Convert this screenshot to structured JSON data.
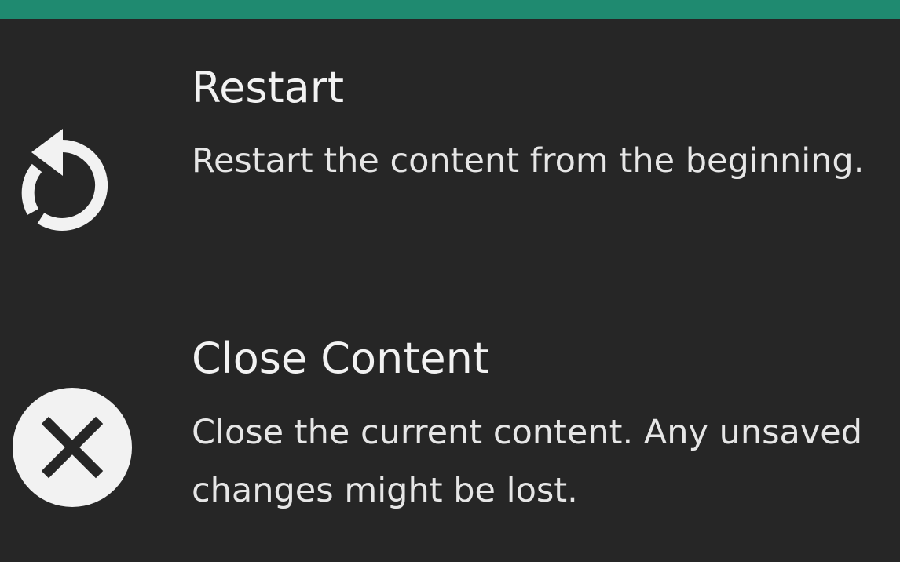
{
  "header": {
    "accent_color": "#1f8a70"
  },
  "menu": {
    "items": [
      {
        "icon": "restart-icon",
        "title": "Restart",
        "description": "Restart the content from the beginning."
      },
      {
        "icon": "close-circle-icon",
        "title": "Close Content",
        "description": "Close the current content. Any unsaved changes might be lost."
      }
    ]
  },
  "colors": {
    "background": "#262626",
    "text": "#ebebeb"
  }
}
